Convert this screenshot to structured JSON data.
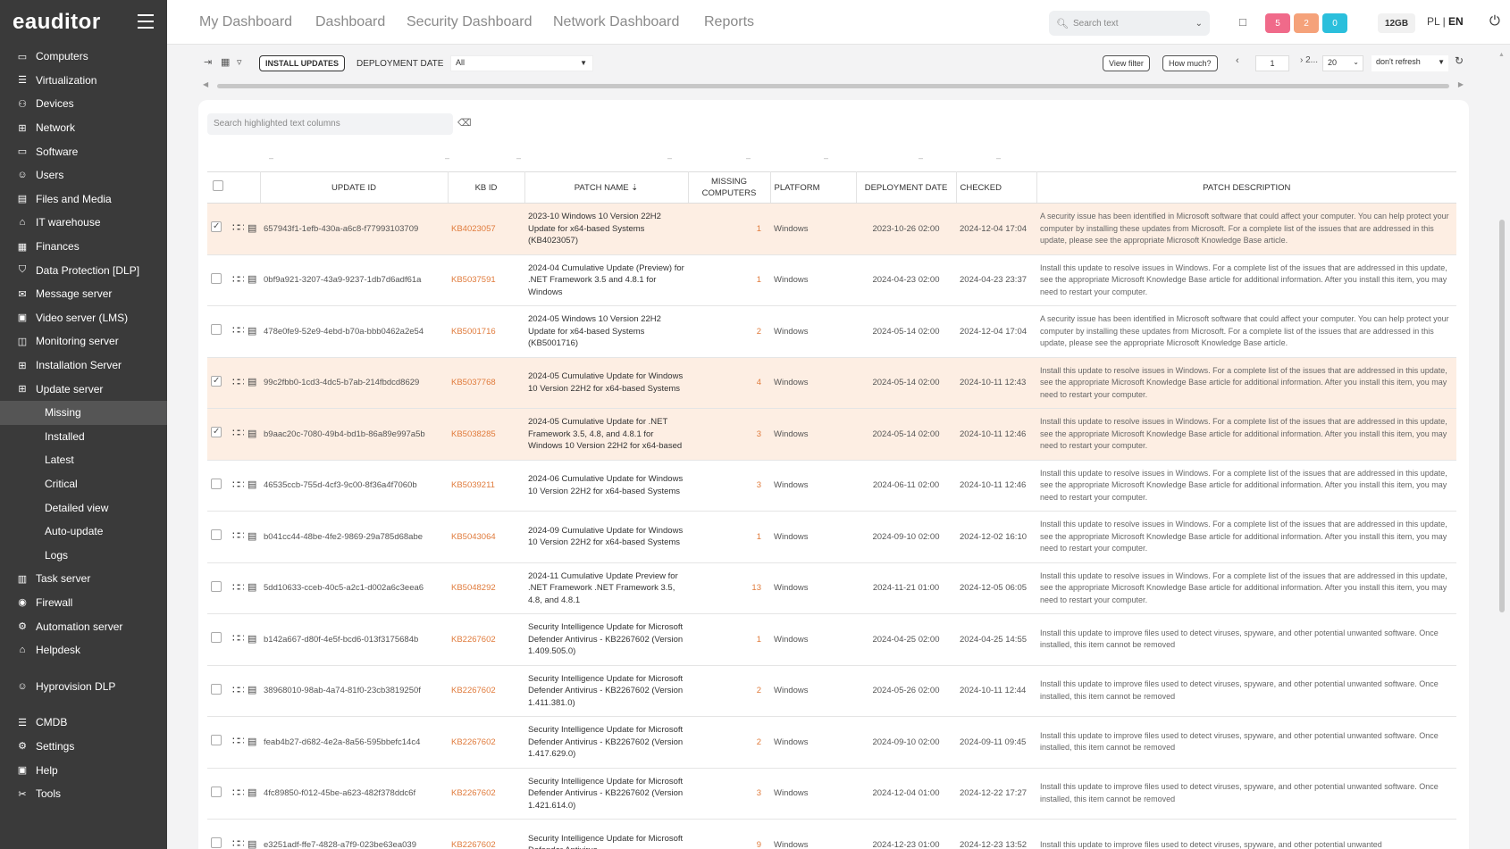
{
  "app": {
    "logo": "eauditor"
  },
  "sidebar": {
    "items": [
      {
        "label": "Computers",
        "icon": "monitor-icon"
      },
      {
        "label": "Virtualization",
        "icon": "server-icon"
      },
      {
        "label": "Devices",
        "icon": "devices-icon"
      },
      {
        "label": "Network",
        "icon": "network-icon"
      },
      {
        "label": "Software",
        "icon": "monitor-icon"
      },
      {
        "label": "Users",
        "icon": "users-icon"
      },
      {
        "label": "Files and Media",
        "icon": "files-icon"
      },
      {
        "label": "IT warehouse",
        "icon": "warehouse-icon"
      },
      {
        "label": "Finances",
        "icon": "finances-icon"
      },
      {
        "label": "Data Protection [DLP]",
        "icon": "shield-icon"
      },
      {
        "label": "Message server",
        "icon": "mail-icon"
      },
      {
        "label": "Video server (LMS)",
        "icon": "video-icon"
      },
      {
        "label": "Monitoring server",
        "icon": "monitoring-icon"
      },
      {
        "label": "Installation Server",
        "icon": "network-icon"
      },
      {
        "label": "Update server",
        "icon": "network-icon"
      }
    ],
    "sub_items": [
      "Missing",
      "Installed",
      "Latest",
      "Critical",
      "Detailed view",
      "Auto-update",
      "Logs"
    ],
    "items2": [
      {
        "label": "Task server",
        "icon": "task-icon"
      },
      {
        "label": "Firewall",
        "icon": "firewall-icon"
      },
      {
        "label": "Automation server",
        "icon": "automation-icon"
      },
      {
        "label": "Helpdesk",
        "icon": "helpdesk-icon"
      }
    ],
    "items3": [
      {
        "label": "Hyprovision DLP",
        "icon": "user-key-icon"
      }
    ],
    "items4": [
      {
        "label": "CMDB",
        "icon": "database-icon"
      },
      {
        "label": "Settings",
        "icon": "gear-icon"
      },
      {
        "label": "Help",
        "icon": "help-icon"
      },
      {
        "label": "Tools",
        "icon": "tools-icon"
      }
    ]
  },
  "topnav": {
    "links": [
      "My Dashboard",
      "Dashboard",
      "Security Dashboard",
      "Network Dashboard",
      "Reports"
    ],
    "search_placeholder": "Search text",
    "badges": [
      {
        "value": "5",
        "color": "#f06a8a"
      },
      {
        "value": "2",
        "color": "#f5a27a"
      },
      {
        "value": "0",
        "color": "#2bbfdc"
      }
    ],
    "memory": "12GB",
    "lang_pl": "PL",
    "lang_sep": "|",
    "lang_en": "EN"
  },
  "toolbar": {
    "install_label": "INSTALL UPDATES",
    "deployment_label": "DEPLOYMENT DATE",
    "deployment_value": "All",
    "view_filter": "View filter",
    "how_much": "How much?",
    "page": "1",
    "next_label": "2...",
    "page_size": "20",
    "refresh": "don't refresh"
  },
  "filter": {
    "placeholder": "Search highlighted text columns"
  },
  "table": {
    "headers": {
      "update_id": "UPDATE ID",
      "kb_id": "KB ID",
      "patch_name": "PATCH NAME ⇣",
      "missing": "MISSING COMPUTERS",
      "platform": "PLATFORM",
      "deployment": "DEPLOYMENT DATE",
      "checked": "CHECKED",
      "description": "PATCH DESCRIPTION"
    },
    "rows": [
      {
        "checked": true,
        "id": "657943f1-1efb-430a-a6c8-f77993103709",
        "kb": "KB4023057",
        "name": "2023-10 Windows 10 Version 22H2 Update for x64-based Systems (KB4023057)",
        "missing": "1",
        "platform": "Windows",
        "deployed": "2023-10-26 02:00",
        "checked_at": "2024-12-04 17:04",
        "desc": "A security issue has been identified in Microsoft software that could affect your computer. You can help protect your computer by installing these updates from Microsoft. For a complete list of the issues that are addressed in this update, please see the appropriate Microsoft Knowledge Base article."
      },
      {
        "checked": false,
        "id": "0bf9a921-3207-43a9-9237-1db7d6adf61a",
        "kb": "KB5037591",
        "name": "2024-04 Cumulative Update (Preview) for .NET Framework 3.5 and 4.8.1 for Windows",
        "missing": "1",
        "platform": "Windows",
        "deployed": "2024-04-23 02:00",
        "checked_at": "2024-04-23 23:37",
        "desc": "Install this update to resolve issues in Windows. For a complete list of the issues that are addressed in this update, see the appropriate Microsoft Knowledge Base article for additional information. After you install this item, you may need to restart your computer."
      },
      {
        "checked": false,
        "id": "478e0fe9-52e9-4ebd-b70a-bbb0462a2e54",
        "kb": "KB5001716",
        "name": "2024-05 Windows 10 Version 22H2 Update for x64-based Systems (KB5001716)",
        "missing": "2",
        "platform": "Windows",
        "deployed": "2024-05-14 02:00",
        "checked_at": "2024-12-04 17:04",
        "desc": "A security issue has been identified in Microsoft software that could affect your computer. You can help protect your computer by installing these updates from Microsoft. For a complete list of the issues that are addressed in this update, please see the appropriate Microsoft Knowledge Base article."
      },
      {
        "checked": true,
        "id": "99c2fbb0-1cd3-4dc5-b7ab-214fbdcd8629",
        "kb": "KB5037768",
        "name": "2024-05 Cumulative Update for Windows 10 Version 22H2 for x64-based Systems",
        "missing": "4",
        "platform": "Windows",
        "deployed": "2024-05-14 02:00",
        "checked_at": "2024-10-11 12:43",
        "desc": "Install this update to resolve issues in Windows. For a complete list of the issues that are addressed in this update, see the appropriate Microsoft Knowledge Base article for additional information. After you install this item, you may need to restart your computer."
      },
      {
        "checked": true,
        "id": "b9aac20c-7080-49b4-bd1b-86a89e997a5b",
        "kb": "KB5038285",
        "name": "2024-05 Cumulative Update for .NET Framework 3.5, 4.8, and 4.8.1 for Windows 10 Version 22H2 for x64-based",
        "missing": "3",
        "platform": "Windows",
        "deployed": "2024-05-14 02:00",
        "checked_at": "2024-10-11 12:46",
        "desc": "Install this update to resolve issues in Windows. For a complete list of the issues that are addressed in this update, see the appropriate Microsoft Knowledge Base article for additional information. After you install this item, you may need to restart your computer."
      },
      {
        "checked": false,
        "id": "46535ccb-755d-4cf3-9c00-8f36a4f7060b",
        "kb": "KB5039211",
        "name": "2024-06 Cumulative Update for Windows 10 Version 22H2 for x64-based Systems",
        "missing": "3",
        "platform": "Windows",
        "deployed": "2024-06-11 02:00",
        "checked_at": "2024-10-11 12:46",
        "desc": "Install this update to resolve issues in Windows. For a complete list of the issues that are addressed in this update, see the appropriate Microsoft Knowledge Base article for additional information. After you install this item, you may need to restart your computer."
      },
      {
        "checked": false,
        "id": "b041cc44-48be-4fe2-9869-29a785d68abe",
        "kb": "KB5043064",
        "name": "2024-09 Cumulative Update for Windows 10 Version 22H2 for x64-based Systems",
        "missing": "1",
        "platform": "Windows",
        "deployed": "2024-09-10 02:00",
        "checked_at": "2024-12-02 16:10",
        "desc": "Install this update to resolve issues in Windows. For a complete list of the issues that are addressed in this update, see the appropriate Microsoft Knowledge Base article for additional information. After you install this item, you may need to restart your computer."
      },
      {
        "checked": false,
        "id": "5dd10633-cceb-40c5-a2c1-d002a6c3eea6",
        "kb": "KB5048292",
        "name": "2024-11 Cumulative Update Preview for .NET Framework .NET Framework 3.5, 4.8, and 4.8.1",
        "missing": "13",
        "platform": "Windows",
        "deployed": "2024-11-21 01:00",
        "checked_at": "2024-12-05 06:05",
        "desc": "Install this update to resolve issues in Windows. For a complete list of the issues that are addressed in this update, see the appropriate Microsoft Knowledge Base article for additional information. After you install this item, you may need to restart your computer."
      },
      {
        "checked": false,
        "id": "b142a667-d80f-4e5f-bcd6-013f3175684b",
        "kb": "KB2267602",
        "name": "Security Intelligence Update for Microsoft Defender Antivirus - KB2267602 (Version 1.409.505.0)",
        "missing": "1",
        "platform": "Windows",
        "deployed": "2024-04-25 02:00",
        "checked_at": "2024-04-25 14:55",
        "desc": "Install this update to improve files used to detect viruses, spyware, and other potential unwanted software. Once installed, this item cannot be removed"
      },
      {
        "checked": false,
        "id": "38968010-98ab-4a74-81f0-23cb3819250f",
        "kb": "KB2267602",
        "name": "Security Intelligence Update for Microsoft Defender Antivirus - KB2267602 (Version 1.411.381.0)",
        "missing": "2",
        "platform": "Windows",
        "deployed": "2024-05-26 02:00",
        "checked_at": "2024-10-11 12:44",
        "desc": "Install this update to improve files used to detect viruses, spyware, and other potential unwanted software. Once installed, this item cannot be removed"
      },
      {
        "checked": false,
        "id": "feab4b27-d682-4e2a-8a56-595bbefc14c4",
        "kb": "KB2267602",
        "name": "Security Intelligence Update for Microsoft Defender Antivirus - KB2267602 (Version 1.417.629.0)",
        "missing": "2",
        "platform": "Windows",
        "deployed": "2024-09-10 02:00",
        "checked_at": "2024-09-11 09:45",
        "desc": "Install this update to improve files used to detect viruses, spyware, and other potential unwanted software. Once installed, this item cannot be removed"
      },
      {
        "checked": false,
        "id": "4fc89850-f012-45be-a623-482f378ddc6f",
        "kb": "KB2267602",
        "name": "Security Intelligence Update for Microsoft Defender Antivirus - KB2267602 (Version 1.421.614.0)",
        "missing": "3",
        "platform": "Windows",
        "deployed": "2024-12-04 01:00",
        "checked_at": "2024-12-22 17:27",
        "desc": "Install this update to improve files used to detect viruses, spyware, and other potential unwanted software. Once installed, this item cannot be removed"
      },
      {
        "checked": false,
        "id": "e3251adf-ffe7-4828-a7f9-023be63ea039",
        "kb": "KB2267602",
        "name": "Security Intelligence Update for Microsoft Defender Antivirus -",
        "missing": "9",
        "platform": "Windows",
        "deployed": "2024-12-23 01:00",
        "checked_at": "2024-12-23 13:52",
        "desc": "Install this update to improve files used to detect viruses, spyware, and other potential unwanted"
      }
    ]
  },
  "colors": {
    "accent": "#e07b3c",
    "highlight_row": "#fdeee3",
    "sidebar_bg": "#3a3a3a"
  }
}
